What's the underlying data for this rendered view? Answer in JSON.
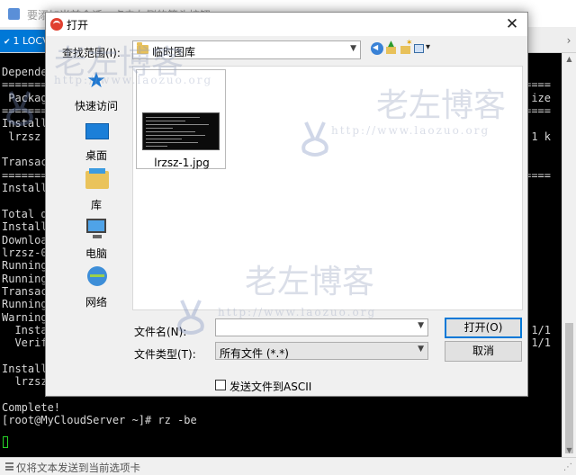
{
  "app": {
    "title": "要添加当前会话，点击左侧的箭头按钮。",
    "tab_label": "1 LOCV",
    "status_text": "仅将文本发送到当前选项卡"
  },
  "terminal": {
    "lines": [
      {
        "row": 0,
        "text": "Depende"
      },
      {
        "row": 1,
        "text": "======="
      },
      {
        "row": 2,
        "text": " Packag"
      },
      {
        "row": 3,
        "text": "======="
      },
      {
        "row": 4,
        "text": "Install"
      },
      {
        "row": 5,
        "text": " lrzsz"
      },
      {
        "row": 6,
        "text": ""
      },
      {
        "row": 7,
        "text": "Transac"
      },
      {
        "row": 8,
        "text": "======="
      },
      {
        "row": 9,
        "text": "Install"
      },
      {
        "row": 10,
        "text": ""
      },
      {
        "row": 11,
        "text": "Total d"
      },
      {
        "row": 12,
        "text": "Install"
      },
      {
        "row": 13,
        "text": "Downloa"
      },
      {
        "row": 14,
        "text": "lrzsz-0"
      },
      {
        "row": 15,
        "text": "Running"
      },
      {
        "row": 16,
        "text": "Running"
      },
      {
        "row": 17,
        "text": "Transac"
      },
      {
        "row": 18,
        "text": "Running"
      },
      {
        "row": 19,
        "text": "Warning"
      },
      {
        "row": 20,
        "text": "  Insta"
      },
      {
        "row": 21,
        "text": "  Verif"
      },
      {
        "row": 22,
        "text": ""
      },
      {
        "row": 23,
        "text": "Install"
      },
      {
        "row": 24,
        "text": "  lrzsz"
      },
      {
        "row": 25,
        "text": ""
      },
      {
        "row": 26,
        "text": "Complete!"
      },
      {
        "row": 27,
        "text": "[root@MyCloudServer ~]# rz -be"
      }
    ],
    "right_lines": [
      {
        "row": 1,
        "text": "====="
      },
      {
        "row": 2,
        "text": "ize"
      },
      {
        "row": 3,
        "text": "====="
      },
      {
        "row": 5,
        "text": "1 k"
      },
      {
        "row": 8,
        "text": "====="
      },
      {
        "row": 20,
        "text": "1/1"
      },
      {
        "row": 21,
        "text": "1/1"
      }
    ]
  },
  "dialog": {
    "title": "打开",
    "look_in_label": "查找范围(I):",
    "look_in_value": "临时图库",
    "places": [
      {
        "label": "快速访问",
        "icon": "quick-access-star-icon"
      },
      {
        "label": "桌面",
        "icon": "desktop-icon"
      },
      {
        "label": "库",
        "icon": "library-icon"
      },
      {
        "label": "电脑",
        "icon": "computer-icon"
      },
      {
        "label": "网络",
        "icon": "network-icon"
      }
    ],
    "files": [
      {
        "name": "lrzsz-1.jpg"
      }
    ],
    "file_name_label": "文件名(N):",
    "file_name_value": "",
    "file_type_label": "文件类型(T):",
    "file_type_value": "所有文件 (*.*)",
    "open_button": "打开(O)",
    "cancel_button": "取消",
    "ascii_checkbox_label": "发送文件到ASCII",
    "ascii_checked": false
  },
  "watermark": {
    "name": "老左博客",
    "url": "http://www.laozuo.org"
  },
  "colors": {
    "accent": "#0078d7",
    "terminal_bg": "#000000",
    "cursor": "#27d427"
  }
}
